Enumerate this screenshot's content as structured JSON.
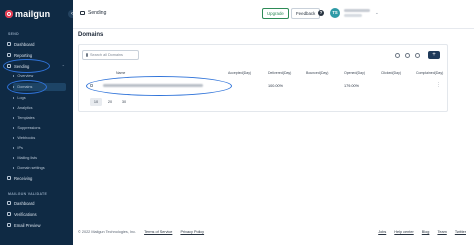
{
  "brand": {
    "name": "mailgun",
    "sub": "by sinch"
  },
  "sidebar": {
    "send_section": "SEND",
    "items": [
      {
        "label": "Dashboard",
        "icon": "dashboard-icon"
      },
      {
        "label": "Reporting",
        "icon": "reporting-icon"
      },
      {
        "label": "Sending",
        "icon": "sending-icon"
      }
    ],
    "sending_sub": [
      {
        "label": "Overview"
      },
      {
        "label": "Domains"
      },
      {
        "label": "Logs"
      },
      {
        "label": "Analytics"
      },
      {
        "label": "Templates"
      },
      {
        "label": "Suppressions"
      },
      {
        "label": "Webhooks"
      },
      {
        "label": "IPs"
      },
      {
        "label": "Mailing lists"
      },
      {
        "label": "Domain settings"
      }
    ],
    "receiving_label": "Receiving",
    "validate_section": "MAILGUN VALIDATE",
    "validate_items": [
      {
        "label": "Dashboard"
      },
      {
        "label": "Verifications"
      },
      {
        "label": "Email Preview"
      }
    ]
  },
  "topbar": {
    "breadcrumb": "Sending",
    "upgrade_label": "Upgrade",
    "feedback_label": "Feedback",
    "help": "?",
    "avatar_initials": "TS"
  },
  "main": {
    "title": "Domains",
    "search_placeholder": "Search all Domains",
    "add_label": "+",
    "columns": [
      "Name",
      "Accepted(Day)",
      "Delivered(Day)",
      "Bounced(Day)",
      "Opened(Day)",
      "Clicked(Day)",
      "Complained(Day)"
    ],
    "rows": [
      {
        "name": "",
        "accepted": "",
        "delivered": "100.00%",
        "bounced": "",
        "opened": "179.00%",
        "clicked": "",
        "complained": ""
      }
    ],
    "page_sizes": [
      "10",
      "20",
      "30"
    ]
  },
  "footer": {
    "copyright": "© 2022 Mailgun Technologies, Inc.",
    "terms": "Terms of Service",
    "privacy": "Privacy Policy",
    "links": [
      "Jobs",
      "Help center",
      "Blog",
      "Team",
      "Twitter"
    ]
  },
  "colors": {
    "sidebar_bg": "#0f2a44",
    "highlight": "#2f73d9",
    "upgrade": "#2e8b57",
    "brand_red": "#e2354c"
  }
}
